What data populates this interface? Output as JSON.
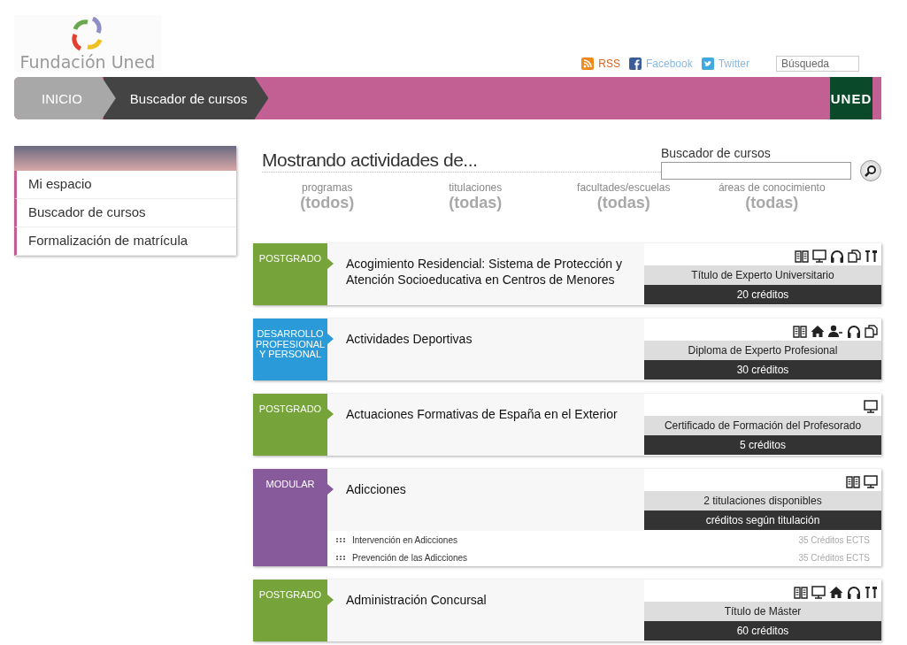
{
  "header": {
    "logo_text": "Fundación Uned",
    "links": [
      {
        "kind": "rss",
        "label": "RSS"
      },
      {
        "kind": "facebook",
        "label": "Facebook"
      },
      {
        "kind": "twitter",
        "label": "Twitter"
      }
    ],
    "search": {
      "placeholder": "Búsqueda"
    }
  },
  "breadcrumb": [
    {
      "label": "INICIO",
      "selected": false
    },
    {
      "label": "Buscador de cursos",
      "selected": true
    }
  ],
  "brand": "UNED",
  "sidebar": {
    "items": [
      {
        "label": "Mi espacio"
      },
      {
        "label": "Buscador de cursos"
      },
      {
        "label": "Formalización de matrícula"
      }
    ]
  },
  "main": {
    "title": "Mostrando actividades de...",
    "search_label": "Buscador de cursos",
    "filters": [
      {
        "label": "programas",
        "value": "(todos)"
      },
      {
        "label": "titulaciones",
        "value": "(todas)"
      },
      {
        "label": "facultades/escuelas",
        "value": "(todas)"
      },
      {
        "label": "áreas de conocimiento",
        "value": "(todas)"
      }
    ],
    "courses": [
      {
        "category": "POSTGRADO",
        "color": "#76a43a",
        "title": "Acogimiento Residencial: Sistema de Protección y Atención Socioeducativa en Centros de Menores",
        "icons": [
          {
            "kind": "book"
          },
          {
            "kind": "monitor"
          },
          {
            "kind": "headphones"
          },
          {
            "kind": "documents"
          },
          {
            "kind": "tools"
          }
        ],
        "degree": "Título de Experto Universitario",
        "credits": "20 créditos"
      },
      {
        "category": "DESARROLLO PROFESIONAL Y PERSONAL",
        "color": "#2a9ad8",
        "title": "Actividades Deportivas",
        "icons": [
          {
            "kind": "book"
          },
          {
            "kind": "house"
          },
          {
            "kind": "person"
          },
          {
            "kind": "headphones"
          },
          {
            "kind": "documents"
          }
        ],
        "degree": "Diploma de Experto Profesional",
        "credits": "30 créditos"
      },
      {
        "category": "POSTGRADO",
        "color": "#76a43a",
        "title": "Actuaciones Formativas de España en el Exterior",
        "icons": [
          {
            "kind": "monitor"
          }
        ],
        "degree": "Certificado de Formación del Profesorado",
        "credits": "5 créditos"
      },
      {
        "category": "MODULAR",
        "color": "#875a9c",
        "title": "Adicciones",
        "icons": [
          {
            "kind": "book"
          },
          {
            "kind": "monitor"
          }
        ],
        "degree": "2 titulaciones disponibles",
        "credits": "créditos según titulación",
        "modules": [
          {
            "name": "Intervención en Adicciones",
            "credits": "35 Créditos ECTS"
          },
          {
            "name": "Prevención de las Adicciones",
            "credits": "35 Créditos ECTS"
          }
        ]
      },
      {
        "category": "POSTGRADO",
        "color": "#76a43a",
        "title": "Administración Concursal",
        "icons": [
          {
            "kind": "book"
          },
          {
            "kind": "monitor"
          },
          {
            "kind": "house"
          },
          {
            "kind": "headphones"
          },
          {
            "kind": "tools"
          }
        ],
        "degree": "Título de Máster",
        "credits": "60 créditos"
      }
    ]
  }
}
